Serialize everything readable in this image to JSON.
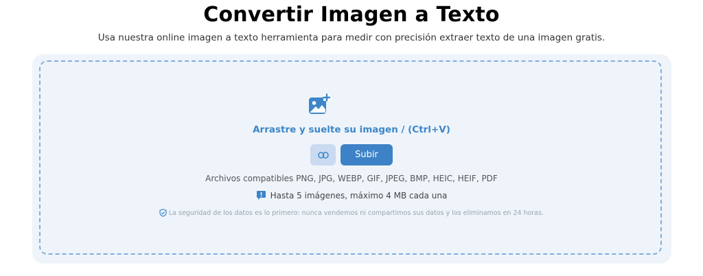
{
  "header": {
    "title": "Convertir Imagen a Texto",
    "subtitle": "Usa nuestra online imagen a texto herramienta para medir con precisión extraer texto de una imagen gratis."
  },
  "upload": {
    "icon": "image-add-icon",
    "drop_text": "Arrastre y suelte su imagen / (Ctrl+V)",
    "link_button_icon": "link-icon",
    "upload_label": "Subir",
    "formats": "Archivos compatibles PNG, JPG, WEBP, GIF, JPEG, BMP, HEIC, HEIF, PDF",
    "limits_icon": "info-bubble-icon",
    "limits": "Hasta 5 imágenes, máximo 4 MB cada una",
    "privacy_icon": "shield-icon",
    "privacy": "La seguridad de los datos es lo primero: nunca vendemos ni compartimos sus datos y los eliminamos en 24 horas."
  },
  "colors": {
    "accent": "#3d82c7",
    "accent_light": "#c9daf1",
    "panel_bg": "#eff4fa",
    "dashed_border": "#7eaedd"
  }
}
